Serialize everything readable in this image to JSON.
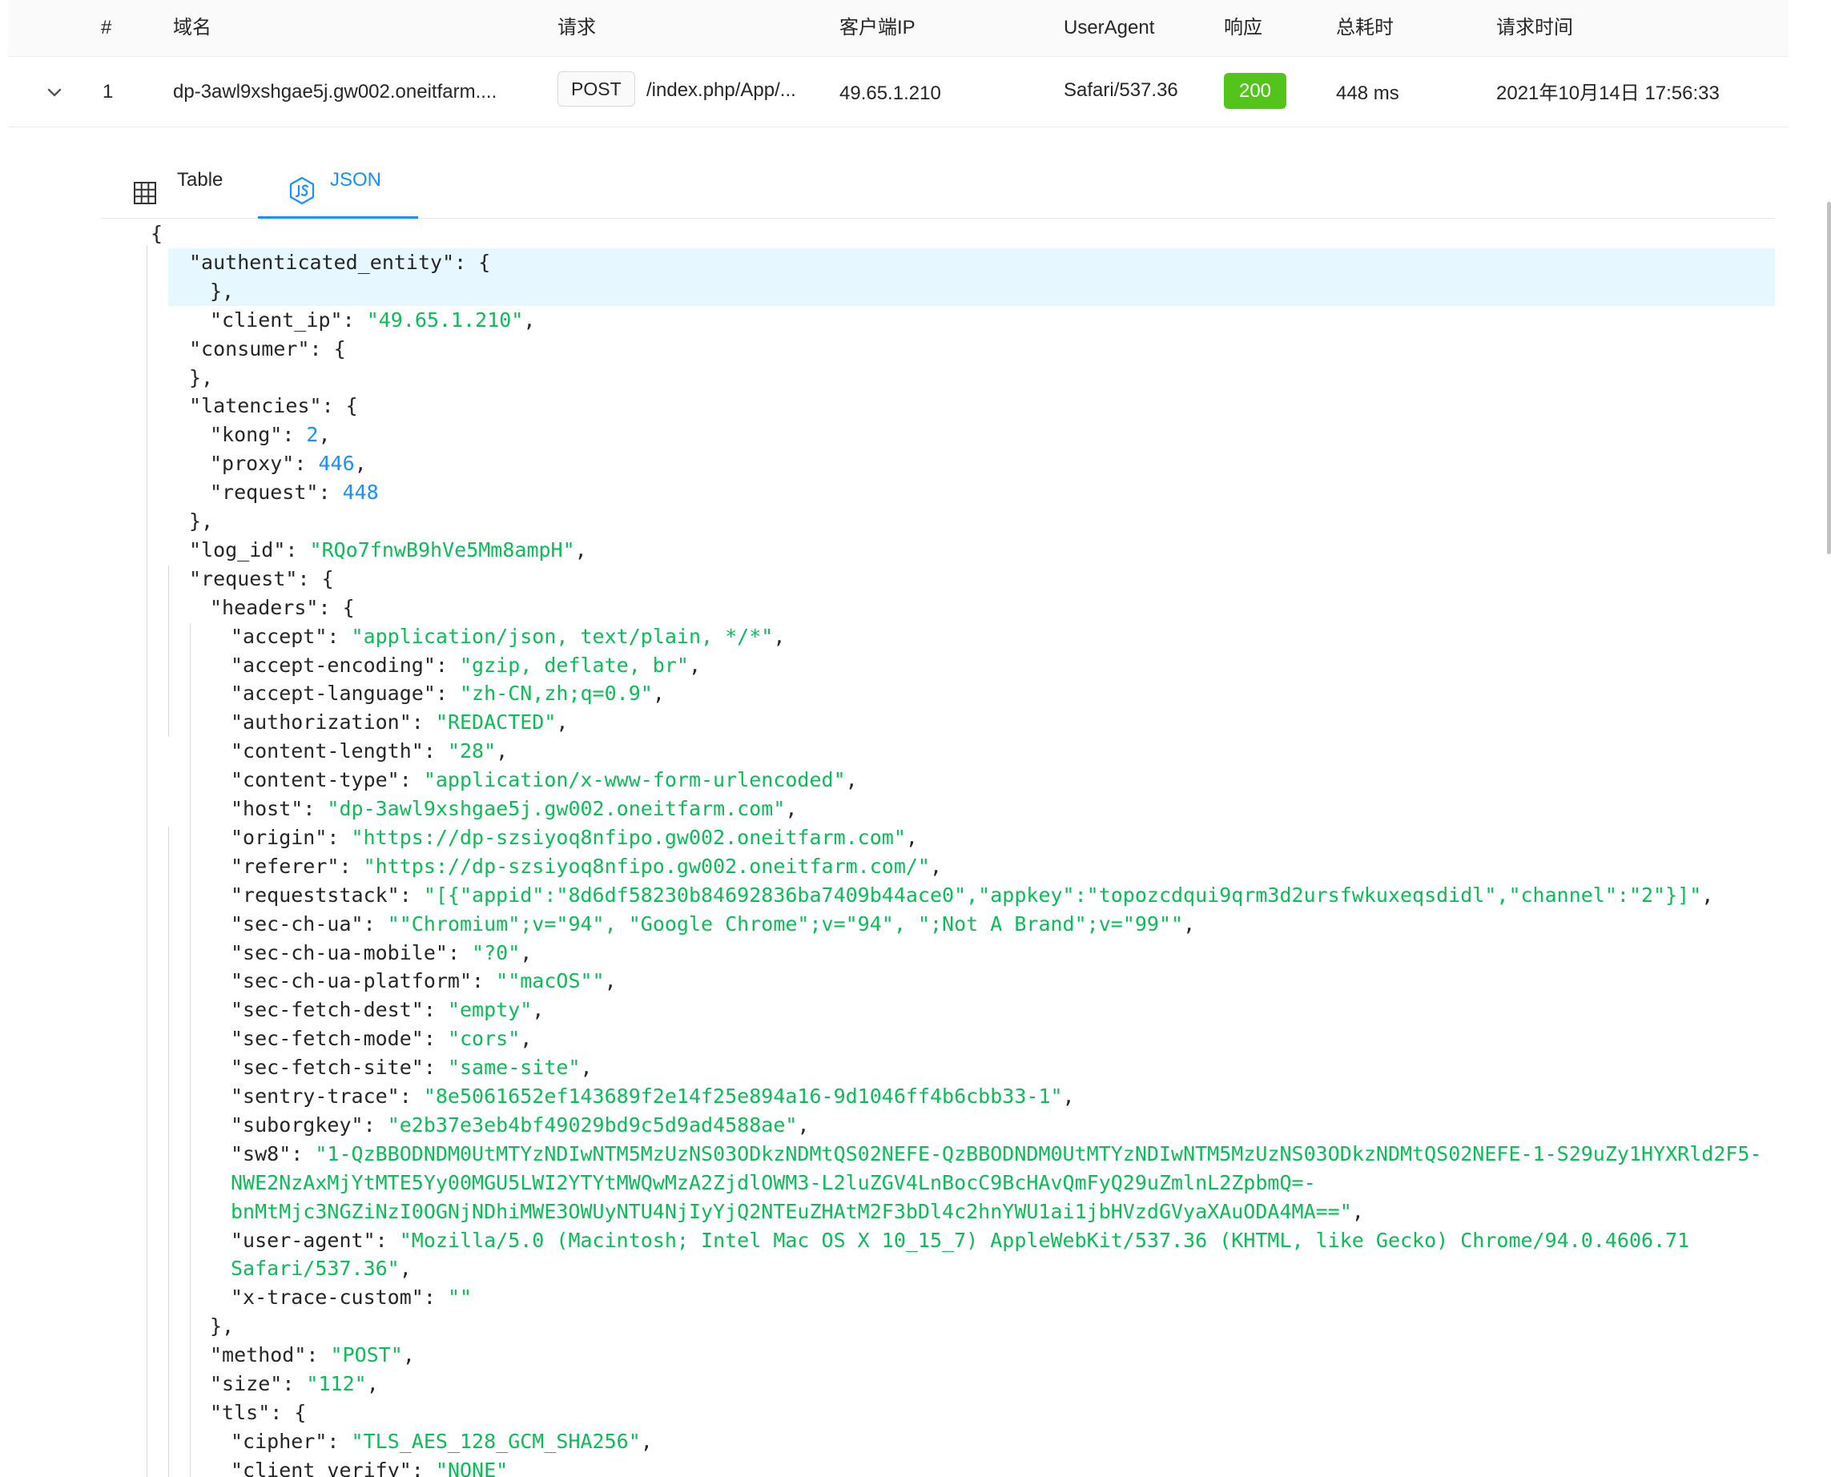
{
  "table": {
    "columns": [
      "#",
      "域名",
      "请求",
      "客户端IP",
      "UserAgent",
      "响应",
      "总耗时",
      "请求时间"
    ],
    "row": {
      "index": "1",
      "domain": "dp-3awl9xshgae5j.gw002.oneitfarm....",
      "method": "POST",
      "path": "/index.php/App/...",
      "client_ip": "49.65.1.210",
      "user_agent": "Safari/537.36",
      "status": "200",
      "latency": "448 ms",
      "time": "2021年10月14日 17:56:33"
    }
  },
  "tabs": {
    "table_label": "Table",
    "json_label": "JSON",
    "active": "JSON"
  },
  "icons": {
    "expand": "chevron-down-icon",
    "table": "grid-icon",
    "json": "js-icon"
  },
  "colors": {
    "status_success": "#52c41a",
    "active_tab": "#1890ff",
    "json_string": "#0bbd56",
    "json_number": "#1890ff",
    "highlight_row": "#e6f7ff"
  },
  "json_lines": [
    {
      "tokens": [
        {
          "t": "p",
          "v": "{"
        }
      ]
    },
    {
      "tokens": [
        {
          "t": "k",
          "v": "\"authenticated_entity\""
        },
        {
          "t": "p",
          "v": ": {"
        }
      ]
    },
    {
      "tokens": [
        {
          "t": "p",
          "v": "},"
        }
      ]
    },
    {
      "tokens": [
        {
          "t": "k",
          "v": "\"client_ip\""
        },
        {
          "t": "p",
          "v": ": "
        },
        {
          "t": "s",
          "v": "\"49.65.1.210\""
        },
        {
          "t": "p",
          "v": ","
        }
      ]
    },
    {
      "tokens": [
        {
          "t": "k",
          "v": "\"consumer\""
        },
        {
          "t": "p",
          "v": ": {"
        }
      ]
    },
    {
      "tokens": [
        {
          "t": "p",
          "v": "},"
        }
      ]
    },
    {
      "tokens": [
        {
          "t": "k",
          "v": "\"latencies\""
        },
        {
          "t": "p",
          "v": ": {"
        }
      ]
    },
    {
      "tokens": [
        {
          "t": "k",
          "v": "\"kong\""
        },
        {
          "t": "p",
          "v": ": "
        },
        {
          "t": "n",
          "v": "2"
        },
        {
          "t": "p",
          "v": ","
        }
      ]
    },
    {
      "tokens": [
        {
          "t": "k",
          "v": "\"proxy\""
        },
        {
          "t": "p",
          "v": ": "
        },
        {
          "t": "n",
          "v": "446"
        },
        {
          "t": "p",
          "v": ","
        }
      ]
    },
    {
      "tokens": [
        {
          "t": "k",
          "v": "\"request\""
        },
        {
          "t": "p",
          "v": ": "
        },
        {
          "t": "n",
          "v": "448"
        }
      ]
    },
    {
      "tokens": [
        {
          "t": "p",
          "v": "},"
        }
      ]
    },
    {
      "tokens": [
        {
          "t": "k",
          "v": "\"log_id\""
        },
        {
          "t": "p",
          "v": ": "
        },
        {
          "t": "s",
          "v": "\"RQo7fnwB9hVe5Mm8ampH\""
        },
        {
          "t": "p",
          "v": ","
        }
      ]
    },
    {
      "tokens": [
        {
          "t": "k",
          "v": "\"request\""
        },
        {
          "t": "p",
          "v": ": {"
        }
      ]
    },
    {
      "tokens": [
        {
          "t": "k",
          "v": "\"headers\""
        },
        {
          "t": "p",
          "v": ": {"
        }
      ]
    },
    {
      "tokens": [
        {
          "t": "k",
          "v": "\"accept\""
        },
        {
          "t": "p",
          "v": ": "
        },
        {
          "t": "s",
          "v": "\"application/json, text/plain, */*\""
        },
        {
          "t": "p",
          "v": ","
        }
      ]
    },
    {
      "tokens": [
        {
          "t": "k",
          "v": "\"accept-encoding\""
        },
        {
          "t": "p",
          "v": ": "
        },
        {
          "t": "s",
          "v": "\"gzip, deflate, br\""
        },
        {
          "t": "p",
          "v": ","
        }
      ]
    },
    {
      "tokens": [
        {
          "t": "k",
          "v": "\"accept-language\""
        },
        {
          "t": "p",
          "v": ": "
        },
        {
          "t": "s",
          "v": "\"zh-CN,zh;q=0.9\""
        },
        {
          "t": "p",
          "v": ","
        }
      ]
    },
    {
      "tokens": [
        {
          "t": "k",
          "v": "\"authorization\""
        },
        {
          "t": "p",
          "v": ": "
        },
        {
          "t": "s",
          "v": "\"REDACTED\""
        },
        {
          "t": "p",
          "v": ","
        }
      ]
    },
    {
      "tokens": [
        {
          "t": "k",
          "v": "\"content-length\""
        },
        {
          "t": "p",
          "v": ": "
        },
        {
          "t": "s",
          "v": "\"28\""
        },
        {
          "t": "p",
          "v": ","
        }
      ]
    },
    {
      "tokens": [
        {
          "t": "k",
          "v": "\"content-type\""
        },
        {
          "t": "p",
          "v": ": "
        },
        {
          "t": "s",
          "v": "\"application/x-www-form-urlencoded\""
        },
        {
          "t": "p",
          "v": ","
        }
      ]
    },
    {
      "tokens": [
        {
          "t": "k",
          "v": "\"host\""
        },
        {
          "t": "p",
          "v": ": "
        },
        {
          "t": "s",
          "v": "\"dp-3awl9xshgae5j.gw002.oneitfarm.com\""
        },
        {
          "t": "p",
          "v": ","
        }
      ]
    },
    {
      "tokens": [
        {
          "t": "k",
          "v": "\"origin\""
        },
        {
          "t": "p",
          "v": ": "
        },
        {
          "t": "s",
          "v": "\"https://dp-szsiyoq8nfipo.gw002.oneitfarm.com\""
        },
        {
          "t": "p",
          "v": ","
        }
      ]
    },
    {
      "tokens": [
        {
          "t": "k",
          "v": "\"referer\""
        },
        {
          "t": "p",
          "v": ": "
        },
        {
          "t": "s",
          "v": "\"https://dp-szsiyoq8nfipo.gw002.oneitfarm.com/\""
        },
        {
          "t": "p",
          "v": ","
        }
      ]
    },
    {
      "tokens": [
        {
          "t": "k",
          "v": "\"requeststack\""
        },
        {
          "t": "p",
          "v": ": "
        },
        {
          "t": "s",
          "v": "\"[{\"appid\":\"8d6df58230b84692836ba7409b44ace0\",\"appkey\":\"topozcdqui9qrm3d2ursfwkuxeqsdidl\",\"channel\":\"2\"}]\""
        },
        {
          "t": "p",
          "v": ","
        }
      ]
    },
    {
      "tokens": [
        {
          "t": "k",
          "v": "\"sec-ch-ua\""
        },
        {
          "t": "p",
          "v": ": "
        },
        {
          "t": "s",
          "v": "\"\"Chromium\";v=\"94\", \"Google Chrome\";v=\"94\", \";Not A Brand\";v=\"99\"\""
        },
        {
          "t": "p",
          "v": ","
        }
      ]
    },
    {
      "tokens": [
        {
          "t": "k",
          "v": "\"sec-ch-ua-mobile\""
        },
        {
          "t": "p",
          "v": ": "
        },
        {
          "t": "s",
          "v": "\"?0\""
        },
        {
          "t": "p",
          "v": ","
        }
      ]
    },
    {
      "tokens": [
        {
          "t": "k",
          "v": "\"sec-ch-ua-platform\""
        },
        {
          "t": "p",
          "v": ": "
        },
        {
          "t": "s",
          "v": "\"\"macOS\"\""
        },
        {
          "t": "p",
          "v": ","
        }
      ]
    },
    {
      "tokens": [
        {
          "t": "k",
          "v": "\"sec-fetch-dest\""
        },
        {
          "t": "p",
          "v": ": "
        },
        {
          "t": "s",
          "v": "\"empty\""
        },
        {
          "t": "p",
          "v": ","
        }
      ]
    },
    {
      "tokens": [
        {
          "t": "k",
          "v": "\"sec-fetch-mode\""
        },
        {
          "t": "p",
          "v": ": "
        },
        {
          "t": "s",
          "v": "\"cors\""
        },
        {
          "t": "p",
          "v": ","
        }
      ]
    },
    {
      "tokens": [
        {
          "t": "k",
          "v": "\"sec-fetch-site\""
        },
        {
          "t": "p",
          "v": ": "
        },
        {
          "t": "s",
          "v": "\"same-site\""
        },
        {
          "t": "p",
          "v": ","
        }
      ]
    },
    {
      "tokens": [
        {
          "t": "k",
          "v": "\"sentry-trace\""
        },
        {
          "t": "p",
          "v": ": "
        },
        {
          "t": "s",
          "v": "\"8e5061652ef143689f2e14f25e894a16-9d1046ff4b6cbb33-1\""
        },
        {
          "t": "p",
          "v": ","
        }
      ]
    },
    {
      "tokens": [
        {
          "t": "k",
          "v": "\"suborgkey\""
        },
        {
          "t": "p",
          "v": ": "
        },
        {
          "t": "s",
          "v": "\"e2b37e3eb4bf49029bd9c5d9ad4588ae\""
        },
        {
          "t": "p",
          "v": ","
        }
      ]
    },
    {
      "tokens": [
        {
          "t": "k",
          "v": "\"sw8\""
        },
        {
          "t": "p",
          "v": ": "
        },
        {
          "t": "s",
          "v": "\"1-QzBBODNDM0UtMTYzNDIwNTM5MzUzNS03ODkzNDMtQS02NEFE-QzBBODNDM0UtMTYzNDIwNTM5MzUzNS03ODkzNDMtQS02NEFE-1-S29uZy1HYXRld2F5-"
        }
      ]
    },
    {
      "tokens": [
        {
          "t": "s",
          "v": "NWE2NzAxMjYtMTE5Yy00MGU5LWI2YTYtMWQwMzA2ZjdlOWM3-L2luZGV4LnBocC9BcHAvQmFyQ29uZmlnL2ZpbmQ=-"
        }
      ]
    },
    {
      "tokens": [
        {
          "t": "s",
          "v": "bnMtMjc3NGZiNzI0OGNjNDhiMWE3OWUyNTU4NjIyYjQ2NTEuZHAtM2F3bDl4c2hnYWU1ai1jbHVzdGVyaXAuODA4MA==\""
        },
        {
          "t": "p",
          "v": ","
        }
      ]
    },
    {
      "tokens": [
        {
          "t": "k",
          "v": "\"user-agent\""
        },
        {
          "t": "p",
          "v": ": "
        },
        {
          "t": "s",
          "v": "\"Mozilla/5.0 (Macintosh; Intel Mac OS X 10_15_7) AppleWebKit/537.36 (KHTML, like Gecko) Chrome/94.0.4606.71"
        }
      ]
    },
    {
      "tokens": [
        {
          "t": "s",
          "v": "Safari/537.36\""
        },
        {
          "t": "p",
          "v": ","
        }
      ]
    },
    {
      "tokens": [
        {
          "t": "k",
          "v": "\"x-trace-custom\""
        },
        {
          "t": "p",
          "v": ": "
        },
        {
          "t": "s",
          "v": "\"\""
        }
      ]
    },
    {
      "tokens": [
        {
          "t": "p",
          "v": "},"
        }
      ]
    },
    {
      "tokens": [
        {
          "t": "k",
          "v": "\"method\""
        },
        {
          "t": "p",
          "v": ": "
        },
        {
          "t": "s",
          "v": "\"POST\""
        },
        {
          "t": "p",
          "v": ","
        }
      ]
    },
    {
      "tokens": [
        {
          "t": "k",
          "v": "\"size\""
        },
        {
          "t": "p",
          "v": ": "
        },
        {
          "t": "s",
          "v": "\"112\""
        },
        {
          "t": "p",
          "v": ","
        }
      ]
    },
    {
      "tokens": [
        {
          "t": "k",
          "v": "\"tls\""
        },
        {
          "t": "p",
          "v": ": {"
        }
      ]
    },
    {
      "tokens": [
        {
          "t": "k",
          "v": "\"cipher\""
        },
        {
          "t": "p",
          "v": ": "
        },
        {
          "t": "s",
          "v": "\"TLS_AES_128_GCM_SHA256\""
        },
        {
          "t": "p",
          "v": ","
        }
      ]
    },
    {
      "tokens": [
        {
          "t": "k",
          "v": "\"client_verify\""
        },
        {
          "t": "p",
          "v": ": "
        },
        {
          "t": "s",
          "v": "\"NONE\""
        }
      ]
    }
  ]
}
